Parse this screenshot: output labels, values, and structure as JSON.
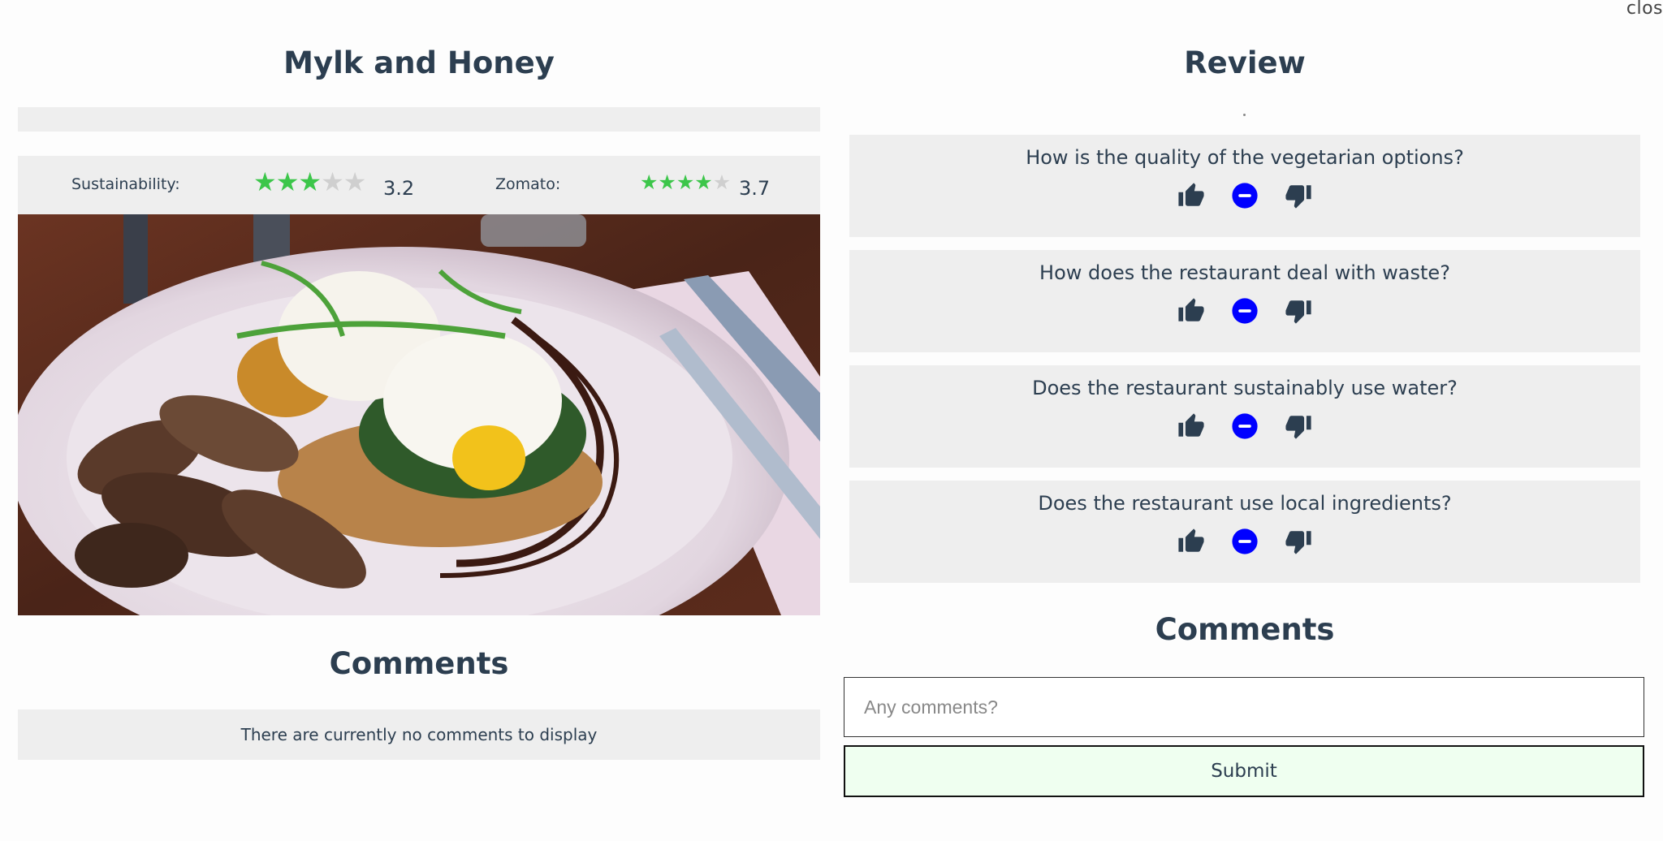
{
  "close_label": "clos",
  "restaurant": {
    "name": "Mylk and Honey",
    "sustainability_label": "Sustainability:",
    "sustainability_rating": 3.2,
    "sustainability_display": "3.2",
    "zomato_label": "Zomato:",
    "zomato_rating": 3.7,
    "zomato_display": "3.7",
    "photo_icon": "food-photo-poached-eggs-mushrooms"
  },
  "comments_section": {
    "title": "Comments",
    "empty_message": "There are currently no comments to display"
  },
  "review": {
    "title": "Review",
    "questions": [
      {
        "text": "How is the quality of the vegetarian options?"
      },
      {
        "text": "How does the restaurant deal with waste?"
      },
      {
        "text": "Does the restaurant sustainably use water?"
      },
      {
        "text": "Does the restaurant use local ingredients?"
      }
    ],
    "icons": {
      "up": "thumbs-up-icon",
      "neutral": "minus-circle-icon",
      "down": "thumbs-down-icon"
    },
    "comments_title": "Comments",
    "comment_placeholder": "Any comments?",
    "submit_label": "Submit"
  },
  "colors": {
    "star": "#3cc64a",
    "neutral_selected": "#0000ff",
    "panel": "#eeeeee",
    "submit_bg": "#effff0"
  }
}
